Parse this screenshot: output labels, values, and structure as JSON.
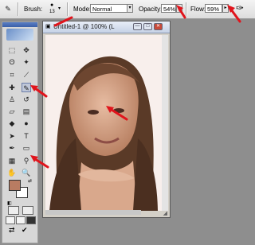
{
  "options_bar": {
    "brush_label": "Brush:",
    "brush_size": "13",
    "mode_label": "Mode:",
    "mode_value": "Normal",
    "opacity_label": "Opacity:",
    "opacity_value": "54%",
    "flow_label": "Flow:",
    "flow_value": "59%"
  },
  "document_window": {
    "title": "Untitled-1 @ 100% (L"
  },
  "colors": {
    "foreground": "#b97c62",
    "background": "#ffffff",
    "annotation_arrow": "#e0141c"
  }
}
